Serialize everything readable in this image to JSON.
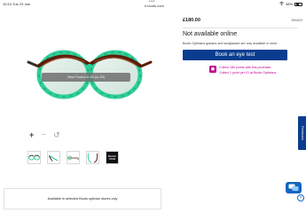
{
  "status_bar": {
    "time": "10:10  Tue 23 Jan",
    "dots": "•••",
    "url": "e.boots.com",
    "battery": "38%"
  },
  "gallery": {
    "overlay_text": "View Product in 3D (or 4D)",
    "controls": {
      "zoom_in": "+",
      "zoom_out": "−",
      "reset": "↺"
    },
    "thumb_brand_text": "BRAND NAME"
  },
  "product": {
    "price": "£180.00",
    "sku": "9094429",
    "availability_heading": "Not available online",
    "availability_desc": "Boots Opticians glasses and sunglasses are only available in store.",
    "book_button": "Book an eye test",
    "points_line1": "Collect 180 points with this purchase.",
    "points_line2": "Collect 1 point per £1 at Boots Opticians."
  },
  "feedback_tab": "Feedback",
  "bottom_bar": {
    "text": "Available in selected Boots optician stores only"
  },
  "colors": {
    "brand_blue": "#0a3d8f",
    "points_magenta": "#c2008f",
    "frame_green": "#2ecf97",
    "frame_tortoise": "#7a2e12"
  }
}
